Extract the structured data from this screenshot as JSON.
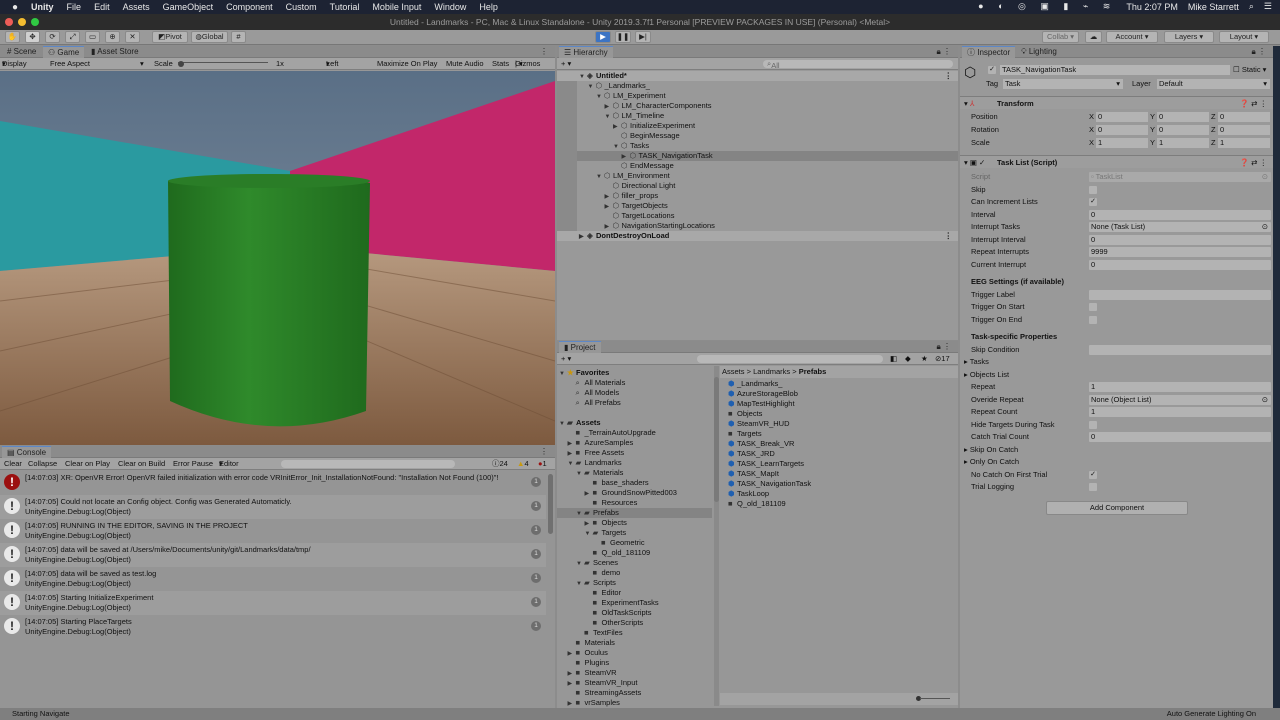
{
  "menubar": {
    "app": "Unity",
    "items": [
      "File",
      "Edit",
      "Assets",
      "GameObject",
      "Component",
      "Custom",
      "Tutorial",
      "Mobile Input",
      "Window",
      "Help"
    ],
    "clock": "Thu 2:07 PM",
    "user": "Mike Starrett"
  },
  "window": {
    "title": "Untitled - Landmarks - PC, Mac & Linux Standalone - Unity 2019.3.7f1 Personal [PREVIEW PACKAGES IN USE] (Personal) <Metal>"
  },
  "toolbar": {
    "pivot": "Pivot",
    "global": "Global",
    "collab": "Collab ▾",
    "account": "Account",
    "layers": "Layers",
    "layout": "Layout",
    "accent": "#3c74c4"
  },
  "game": {
    "tabs": [
      "Scene",
      "Game",
      "Asset Store"
    ],
    "display": "Display 1",
    "aspect": "Free Aspect",
    "scale_label": "Scale",
    "scale_value": "1x",
    "eye": "Left Eye",
    "maximize": "Maximize On Play",
    "mute": "Mute Audio",
    "stats": "Stats",
    "gizmos": "Gizmos",
    "colors": {
      "cyan_wall": "#2a9aa0",
      "magenta_wall": "#c2276a",
      "floor": "#8d6a4d",
      "cylinder": "#2a7d27"
    }
  },
  "console": {
    "title": "Console",
    "buttons": [
      "Clear",
      "Collapse",
      "Clear on Play",
      "Clear on Build",
      "Error Pause",
      "Editor"
    ],
    "counts": {
      "log": "24",
      "warn": "4",
      "error": "1"
    },
    "rows": [
      {
        "type": "error",
        "line1": "[14:07:03] XR: OpenVR Error! OpenVR failed initialization with error code VRInitError_Init_InstallationNotFound: \"Installation Not Found (100)\"!",
        "line2": "",
        "count": "1"
      },
      {
        "type": "log",
        "line1": "[14:07:05] Could not locate an Config object.  Config was Generated Automaticly.",
        "line2": "UnityEngine.Debug:Log(Object)",
        "count": "1"
      },
      {
        "type": "log",
        "line1": "[14:07:05] RUNNING IN THE EDITOR, SAVING IN THE PROJECT",
        "line2": "UnityEngine.Debug:Log(Object)",
        "count": "1"
      },
      {
        "type": "log",
        "line1": "[14:07:05] data will be saved at /Users/mike/Documents/unity/git/Landmarks/data/tmp/",
        "line2": "UnityEngine.Debug:Log(Object)",
        "count": "1"
      },
      {
        "type": "log",
        "line1": "[14:07:05] data will be saved as test.log",
        "line2": "UnityEngine.Debug:Log(Object)",
        "count": "1"
      },
      {
        "type": "log",
        "line1": "[14:07:05] Starting InitializeExperiment",
        "line2": "UnityEngine.Debug:Log(Object)",
        "count": "1"
      },
      {
        "type": "log",
        "line1": "[14:07:05] Starting PlaceTargets",
        "line2": "UnityEngine.Debug:Log(Object)",
        "count": "1"
      }
    ]
  },
  "hierarchy": {
    "title": "Hierarchy",
    "search_placeholder": "All",
    "items": [
      {
        "label": "Untitled*",
        "depth": 0,
        "arrow": "down",
        "scene": true
      },
      {
        "label": "_Landmarks_",
        "depth": 1,
        "arrow": "down"
      },
      {
        "label": "LM_Experiment",
        "depth": 2,
        "arrow": "down"
      },
      {
        "label": "LM_CharacterComponents",
        "depth": 3,
        "arrow": "right"
      },
      {
        "label": "LM_Timeline",
        "depth": 3,
        "arrow": "down"
      },
      {
        "label": "InitializeExperiment",
        "depth": 4,
        "arrow": "right"
      },
      {
        "label": "BeginMessage",
        "depth": 4,
        "arrow": ""
      },
      {
        "label": "Tasks",
        "depth": 4,
        "arrow": "down"
      },
      {
        "label": "TASK_NavigationTask",
        "depth": 5,
        "arrow": "right",
        "selected": true
      },
      {
        "label": "EndMessage",
        "depth": 4,
        "arrow": ""
      },
      {
        "label": "LM_Environment",
        "depth": 2,
        "arrow": "down"
      },
      {
        "label": "Directional Light",
        "depth": 3,
        "arrow": ""
      },
      {
        "label": "filler_props",
        "depth": 3,
        "arrow": "right"
      },
      {
        "label": "TargetObjects",
        "depth": 3,
        "arrow": "right"
      },
      {
        "label": "TargetLocations",
        "depth": 3,
        "arrow": ""
      },
      {
        "label": "NavigationStartingLocations",
        "depth": 3,
        "arrow": "right"
      },
      {
        "label": "DontDestroyOnLoad",
        "depth": 0,
        "arrow": "right",
        "scene": true
      }
    ]
  },
  "project": {
    "title": "Project",
    "hidden_count": "17",
    "breadcrumb": [
      "Assets",
      "Landmarks",
      "Prefabs"
    ],
    "tree": [
      {
        "label": "Favorites",
        "depth": 0,
        "arrow": "down",
        "icon": "star",
        "bold": true
      },
      {
        "label": "All Materials",
        "depth": 1,
        "arrow": "",
        "icon": "search"
      },
      {
        "label": "All Models",
        "depth": 1,
        "arrow": "",
        "icon": "search"
      },
      {
        "label": "All Prefabs",
        "depth": 1,
        "arrow": "",
        "icon": "search"
      },
      {
        "label": "",
        "depth": 0,
        "arrow": "",
        "icon": "none"
      },
      {
        "label": "Assets",
        "depth": 0,
        "arrow": "down",
        "icon": "folder-open",
        "bold": true
      },
      {
        "label": "_TerrainAutoUpgrade",
        "depth": 1,
        "arrow": "",
        "icon": "folder"
      },
      {
        "label": "AzureSamples",
        "depth": 1,
        "arrow": "right",
        "icon": "folder"
      },
      {
        "label": "Free Assets",
        "depth": 1,
        "arrow": "right",
        "icon": "folder"
      },
      {
        "label": "Landmarks",
        "depth": 1,
        "arrow": "down",
        "icon": "folder-open"
      },
      {
        "label": "Materials",
        "depth": 2,
        "arrow": "down",
        "icon": "folder-open"
      },
      {
        "label": "base_shaders",
        "depth": 3,
        "arrow": "",
        "icon": "folder"
      },
      {
        "label": "GroundSnowPitted003",
        "depth": 3,
        "arrow": "right",
        "icon": "folder"
      },
      {
        "label": "Resources",
        "depth": 3,
        "arrow": "",
        "icon": "folder"
      },
      {
        "label": "Prefabs",
        "depth": 2,
        "arrow": "down",
        "icon": "folder-open",
        "selected": true
      },
      {
        "label": "Objects",
        "depth": 3,
        "arrow": "right",
        "icon": "folder"
      },
      {
        "label": "Targets",
        "depth": 3,
        "arrow": "down",
        "icon": "folder-open"
      },
      {
        "label": "Geometric",
        "depth": 4,
        "arrow": "",
        "icon": "folder"
      },
      {
        "label": "Q_old_181109",
        "depth": 3,
        "arrow": "",
        "icon": "folder"
      },
      {
        "label": "Scenes",
        "depth": 2,
        "arrow": "down",
        "icon": "folder-open"
      },
      {
        "label": "demo",
        "depth": 3,
        "arrow": "",
        "icon": "folder"
      },
      {
        "label": "Scripts",
        "depth": 2,
        "arrow": "down",
        "icon": "folder-open"
      },
      {
        "label": "Editor",
        "depth": 3,
        "arrow": "",
        "icon": "folder"
      },
      {
        "label": "ExperimentTasks",
        "depth": 3,
        "arrow": "",
        "icon": "folder"
      },
      {
        "label": "OldTaskScripts",
        "depth": 3,
        "arrow": "",
        "icon": "folder"
      },
      {
        "label": "OtherScripts",
        "depth": 3,
        "arrow": "",
        "icon": "folder"
      },
      {
        "label": "TextFiles",
        "depth": 2,
        "arrow": "",
        "icon": "folder"
      },
      {
        "label": "Materials",
        "depth": 1,
        "arrow": "",
        "icon": "folder"
      },
      {
        "label": "Oculus",
        "depth": 1,
        "arrow": "right",
        "icon": "folder"
      },
      {
        "label": "Plugins",
        "depth": 1,
        "arrow": "",
        "icon": "folder"
      },
      {
        "label": "SteamVR",
        "depth": 1,
        "arrow": "right",
        "icon": "folder"
      },
      {
        "label": "SteamVR_Input",
        "depth": 1,
        "arrow": "right",
        "icon": "folder"
      },
      {
        "label": "StreamingAssets",
        "depth": 1,
        "arrow": "",
        "icon": "folder"
      },
      {
        "label": "vrSamples",
        "depth": 1,
        "arrow": "right",
        "icon": "folder"
      }
    ],
    "files": [
      {
        "label": "_Landmarks_",
        "icon": "prefab"
      },
      {
        "label": "AzureStorageBlob",
        "icon": "prefab"
      },
      {
        "label": "MapTestHighlight",
        "icon": "prefab"
      },
      {
        "label": "Objects",
        "icon": "folder"
      },
      {
        "label": "SteamVR_HUD",
        "icon": "prefab"
      },
      {
        "label": "Targets",
        "icon": "folder"
      },
      {
        "label": "TASK_Break_VR",
        "icon": "prefab"
      },
      {
        "label": "TASK_JRD",
        "icon": "prefab"
      },
      {
        "label": "TASK_LearnTargets",
        "icon": "prefab"
      },
      {
        "label": "TASK_MapIt",
        "icon": "prefab"
      },
      {
        "label": "TASK_NavigationTask",
        "icon": "prefab"
      },
      {
        "label": "TaskLoop",
        "icon": "prefab"
      },
      {
        "label": "Q_old_181109",
        "icon": "folder"
      }
    ]
  },
  "inspector": {
    "tabs": [
      "Inspector",
      "Lighting"
    ],
    "object_name": "TASK_NavigationTask",
    "static_label": "Static",
    "tag_label": "Tag",
    "tag": "Task",
    "layer_label": "Layer",
    "layer": "Default",
    "transform": {
      "title": "Transform",
      "rows": [
        {
          "label": "Position",
          "x": "0",
          "y": "0",
          "z": "0"
        },
        {
          "label": "Rotation",
          "x": "0",
          "y": "0",
          "z": "0"
        },
        {
          "label": "Scale",
          "x": "1",
          "y": "1",
          "z": "1"
        }
      ]
    },
    "script": {
      "title": "Task List (Script)",
      "rows": [
        {
          "label": "Script",
          "kind": "field",
          "value": "TaskList",
          "disabled": true
        },
        {
          "label": "Skip",
          "kind": "check",
          "checked": false
        },
        {
          "label": "Can Increment Lists",
          "kind": "check",
          "checked": true
        },
        {
          "label": "Interval",
          "kind": "field",
          "value": "0"
        },
        {
          "label": "Interrupt Tasks",
          "kind": "field",
          "value": "None (Task List)",
          "picker": true
        },
        {
          "label": "Interrupt Interval",
          "kind": "field",
          "value": "0"
        },
        {
          "label": "Repeat Interrupts",
          "kind": "field",
          "value": "9999"
        },
        {
          "label": "Current Interrupt",
          "kind": "field",
          "value": "0"
        },
        {
          "label": "EEG Settings (if available)",
          "kind": "header",
          "gap": true
        },
        {
          "label": "Trigger Label",
          "kind": "field",
          "value": ""
        },
        {
          "label": "Trigger On Start",
          "kind": "check",
          "checked": false
        },
        {
          "label": "Trigger On End",
          "kind": "check",
          "checked": false
        },
        {
          "label": "Task-specific Properties",
          "kind": "header",
          "gap": true
        },
        {
          "label": "Skip Condition",
          "kind": "field",
          "value": ""
        },
        {
          "label": "Tasks",
          "kind": "fold"
        },
        {
          "label": "Objects List",
          "kind": "fold"
        },
        {
          "label": "Repeat",
          "kind": "field",
          "value": "1"
        },
        {
          "label": "Overide Repeat",
          "kind": "field",
          "value": "None (Object List)",
          "picker": true
        },
        {
          "label": "Repeat Count",
          "kind": "field",
          "value": "1"
        },
        {
          "label": "Hide Targets During Task",
          "kind": "check",
          "checked": false
        },
        {
          "label": "Catch Trial Count",
          "kind": "field",
          "value": "0"
        },
        {
          "label": "Skip On Catch",
          "kind": "fold"
        },
        {
          "label": "Only On Catch",
          "kind": "fold"
        },
        {
          "label": "No Catch On First Trial",
          "kind": "check",
          "checked": true
        },
        {
          "label": "Trial Logging",
          "kind": "check",
          "checked": false
        }
      ]
    },
    "add_component": "Add Component"
  },
  "statusbar": {
    "left": "Starting Navigate",
    "right": "Auto Generate Lighting On"
  }
}
